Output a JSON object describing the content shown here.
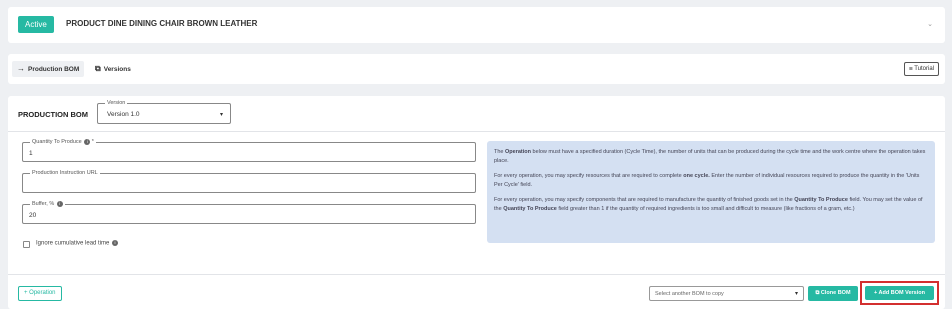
{
  "header": {
    "status_badge": "Active",
    "product_title": "PRODUCT DINE DINING CHAIR BROWN LEATHER",
    "collapse_icon": "chevron-down-icon"
  },
  "tabs": [
    {
      "label": "Production BOM",
      "icon": "arrow-right-icon",
      "active": true
    },
    {
      "label": "Versions",
      "icon": "copy-icon",
      "active": false
    }
  ],
  "toolbar": {
    "tutorial_label": "Tutorial",
    "tutorial_icon": "signpost-icon"
  },
  "bom": {
    "title": "PRODUCTION BOM",
    "version_label": "Version",
    "version_value": "Version 1.0"
  },
  "form": {
    "quantity_label": "Quantity To Produce",
    "quantity_required": "*",
    "quantity_value": "1",
    "url_label": "Production Instruction URL",
    "url_value": "",
    "buffer_label": "Buffer, %",
    "buffer_value": "20",
    "ignore_label": "Ignore cumulative lead time"
  },
  "note": {
    "p1_pre": "The ",
    "p1_bold": "Operation",
    "p1_post": " below must have a specified duration (Cycle Time), the number of units that can be produced during the cycle time and the work centre where the operation takes place.",
    "p2_pre": "For every operation, you may specify resources that are required to complete ",
    "p2_bold": "one cycle.",
    "p2_post": " Enter the number of individual resources required to produce the quantity in the 'Units Per Cycle' field.",
    "p3_pre": "For every operation, you may specify components that are required to manufacture the quantity of finished goods set in the ",
    "p3_bold1": "Quantity To Produce",
    "p3_mid": " field. You may set the value of the ",
    "p3_bold2": "Quantity To Produce",
    "p3_post": " field greater than 1 if the quantity of required ingredients is too small and difficult to measure (like fractions of a gram, etc.)"
  },
  "footer": {
    "operation_button": "+ Operation",
    "bom_select_placeholder": "Select another BOM to copy",
    "clone_button": "Clone BOM",
    "add_version_button": "+ Add BOM Version"
  },
  "colors": {
    "accent": "#26b9a3",
    "note_bg": "#d4e0f2",
    "highlight": "#d32f2f"
  }
}
